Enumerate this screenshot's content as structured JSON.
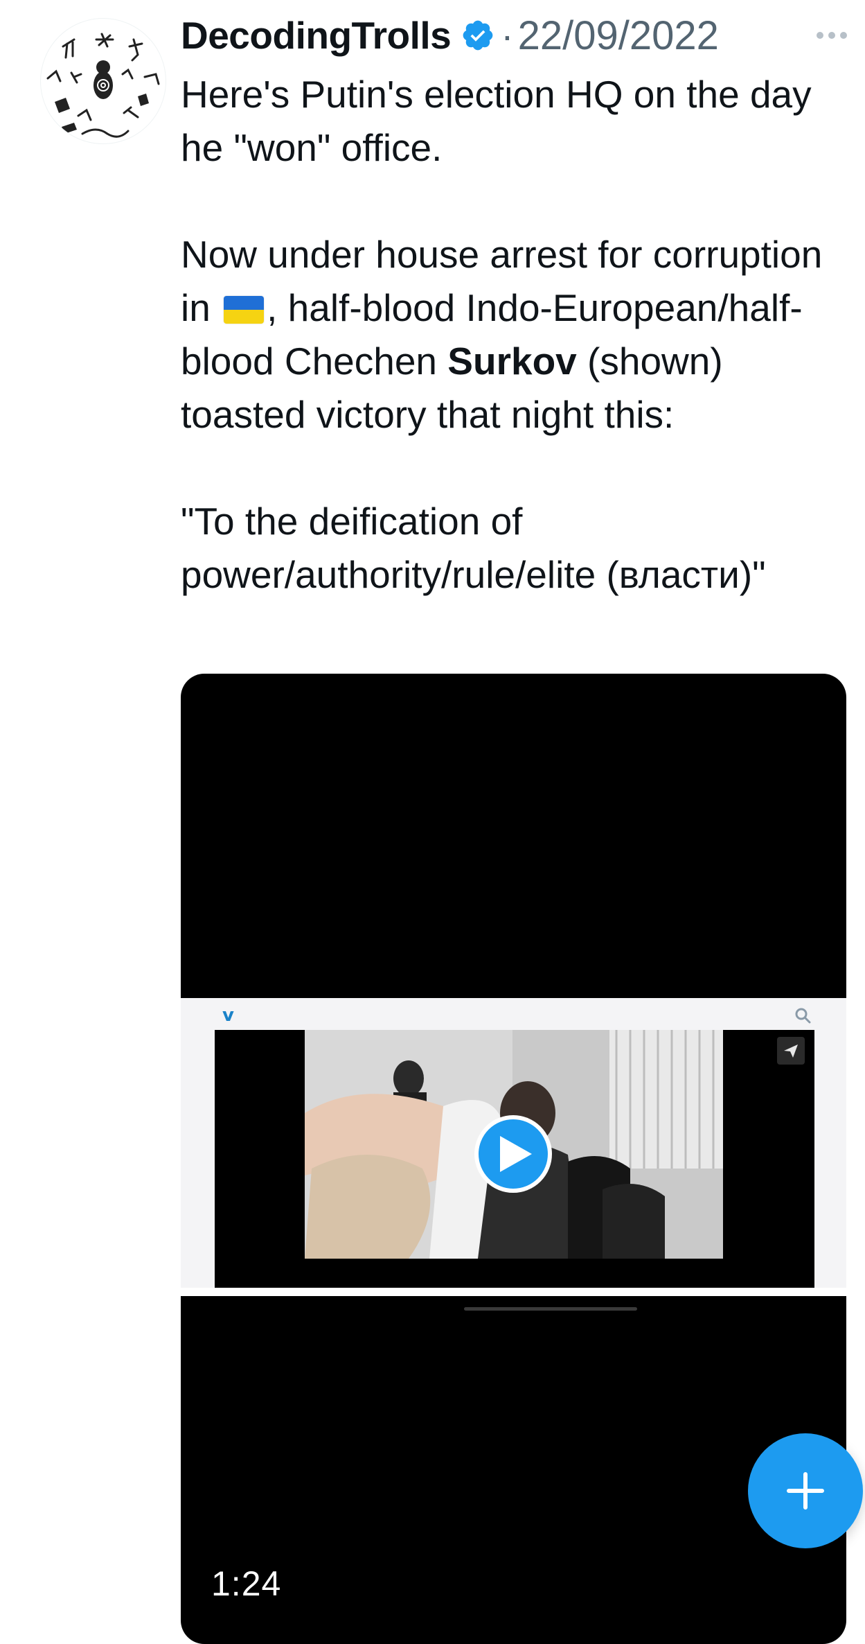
{
  "tweet": {
    "author_name": "DecodingTrolls",
    "separator": "·",
    "date": "22/09/2022",
    "body": {
      "line1": "Here's Putin's election HQ on the day he \"won\" office.",
      "para2_before_flag": "Now under house arrest for corruption in ",
      "para2_after_flag": ", half-blood Indo-European/half-blood Chechen ",
      "para2_bold": "Surkov",
      "para2_rest": " (shown) toasted victory that night this:",
      "quote": "\"To the deification of power/authority/rule/elite (власти)\""
    }
  },
  "video": {
    "duration": "1:24",
    "embedded_logo": "v"
  },
  "icons": {
    "verified": "verified-badge-icon",
    "more": "more-icon",
    "play": "play-icon",
    "compose": "plus-icon",
    "flag": "ukraine-flag-emoji"
  },
  "colors": {
    "accent": "#1d9bf0",
    "text": "#0f1419",
    "secondary_text": "#536471",
    "flag_blue": "#1f6fd6",
    "flag_yellow": "#f5d312"
  }
}
